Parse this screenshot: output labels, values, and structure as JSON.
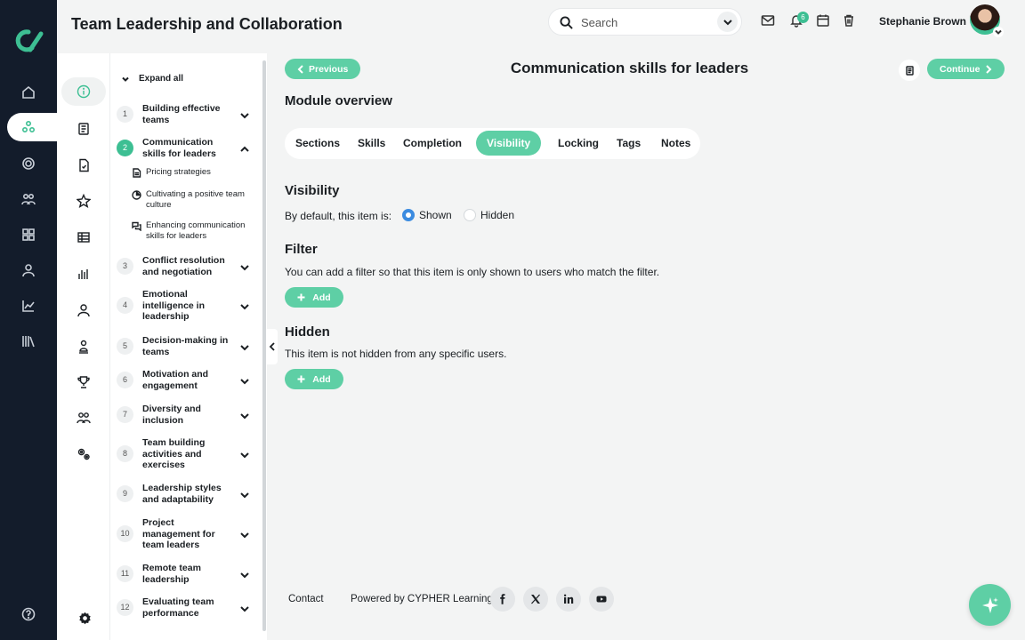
{
  "app": {
    "title": "Team Leadership and Collaboration"
  },
  "search": {
    "placeholder": "Search"
  },
  "header": {
    "notification_count": "6",
    "user_name": "Stephanie Brown"
  },
  "outline": {
    "expand_all": "Expand all",
    "items": [
      {
        "num": "1",
        "label": "Building effective teams"
      },
      {
        "num": "2",
        "label": "Communication skills for leaders",
        "expanded": true,
        "children": [
          {
            "icon": "document-icon",
            "label": "Pricing strategies"
          },
          {
            "icon": "pie-chart-icon",
            "label": "Cultivating a positive team culture"
          },
          {
            "icon": "chat-bubbles-icon",
            "label": "Enhancing communication skills for leaders"
          }
        ]
      },
      {
        "num": "3",
        "label": "Conflict resolution and negotiation"
      },
      {
        "num": "4",
        "label": "Emotional intelligence in leadership"
      },
      {
        "num": "5",
        "label": "Decision-making in teams"
      },
      {
        "num": "6",
        "label": "Motivation and engagement"
      },
      {
        "num": "7",
        "label": "Diversity and inclusion"
      },
      {
        "num": "8",
        "label": "Team building activities and exercises"
      },
      {
        "num": "9",
        "label": "Leadership styles and adaptability"
      },
      {
        "num": "10",
        "label": "Project management for team leaders"
      },
      {
        "num": "11",
        "label": "Remote team leadership"
      },
      {
        "num": "12",
        "label": "Evaluating team performance"
      }
    ]
  },
  "main": {
    "previous_label": "Previous",
    "continue_label": "Continue",
    "page_title": "Communication skills for leaders",
    "module_heading": "Module overview",
    "tabs": [
      {
        "label": "Sections"
      },
      {
        "label": "Skills"
      },
      {
        "label": "Completion"
      },
      {
        "label": "Visibility",
        "active": true
      },
      {
        "label": "Locking"
      },
      {
        "label": "Tags"
      },
      {
        "label": "Notes"
      }
    ],
    "visibility": {
      "heading": "Visibility",
      "default_text": "By default, this item is:",
      "option_shown": "Shown",
      "option_hidden": "Hidden",
      "selected": "Shown"
    },
    "filter": {
      "heading": "Filter",
      "text": "You can add a filter so that this item is only shown to users who match the filter.",
      "add_label": "Add"
    },
    "hidden": {
      "heading": "Hidden",
      "text": "This item is not hidden from any specific users.",
      "add_label": "Add"
    }
  },
  "footer": {
    "contact": "Contact",
    "powered_by": "Powered by CYPHER Learning",
    "social": [
      "facebook-icon",
      "x-icon",
      "linkedin-icon",
      "youtube-icon"
    ]
  },
  "colors": {
    "accent": "#5ecfa5",
    "rail": "#131c2b",
    "radio": "#3b8be0"
  }
}
